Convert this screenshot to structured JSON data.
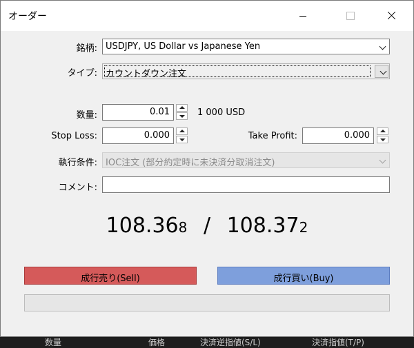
{
  "window": {
    "title": "オーダー"
  },
  "form": {
    "symbol_label": "銘柄:",
    "symbol_value": "USDJPY, US Dollar vs Japanese Yen",
    "type_label": "タイプ:",
    "type_value": "カウントダウン注文",
    "volume_label": "数量:",
    "volume_value": "0.01",
    "volume_note": "1 000 USD",
    "sl_label": "Stop Loss:",
    "sl_value": "0.000",
    "tp_label": "Take Profit:",
    "tp_value": "0.000",
    "fill_label": "執行条件:",
    "fill_value": "IOC注文 (部分約定時に未決済分取消注文)",
    "comment_label": "コメント:",
    "comment_value": ""
  },
  "prices": {
    "bid_main": "108.36",
    "bid_small": "8",
    "separator": "/",
    "ask_main": "108.37",
    "ask_small": "2"
  },
  "buttons": {
    "sell_label": "成行売り(Sell)",
    "buy_label": "成行買い(Buy)"
  },
  "progress": {
    "fraction": 0
  },
  "background": {
    "col1": "数量",
    "col2": "価格",
    "col3": "決済逆指値(S/L)",
    "col4": "決済指値(T/P)"
  },
  "colors": {
    "sell": "#d55a5a",
    "buy": "#7e9fdc"
  }
}
